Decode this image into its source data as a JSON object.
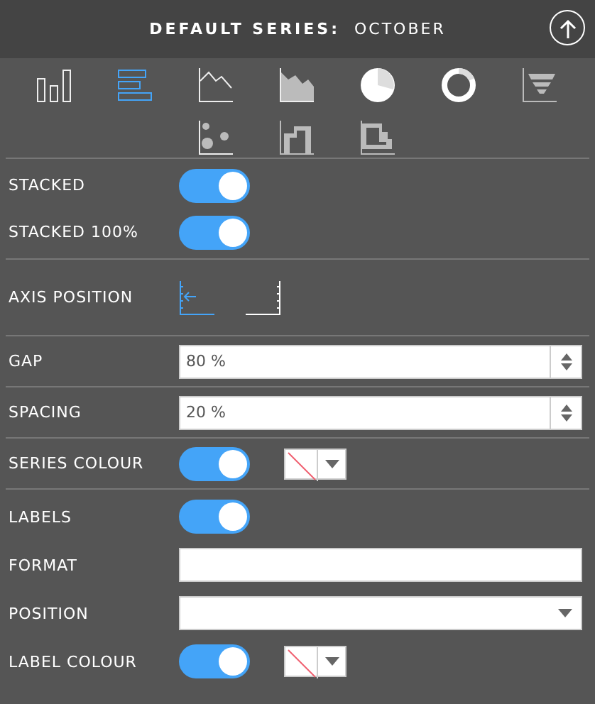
{
  "header": {
    "label": "DEFAULT SERIES:",
    "value": "OCTOBER"
  },
  "chart_types": [
    {
      "kind": "column",
      "selected": false
    },
    {
      "kind": "bar",
      "selected": true
    },
    {
      "kind": "line",
      "selected": false
    },
    {
      "kind": "area",
      "selected": false
    },
    {
      "kind": "pie",
      "selected": false
    },
    {
      "kind": "donut",
      "selected": false
    },
    {
      "kind": "funnel",
      "selected": false
    },
    {
      "kind": "scatter",
      "selected": false
    },
    {
      "kind": "step",
      "selected": false
    },
    {
      "kind": "stepbar",
      "selected": false
    }
  ],
  "groups": [
    [
      {
        "kind": "toggle",
        "label": "STACKED",
        "on": true
      },
      {
        "kind": "toggle",
        "label": "STACKED 100%",
        "on": true
      }
    ],
    [
      {
        "kind": "axis",
        "label": "AXIS POSITION",
        "options": [
          {
            "kind": "left",
            "selected": true
          },
          {
            "kind": "right",
            "selected": false
          }
        ]
      }
    ],
    [
      {
        "kind": "spinner",
        "label": "GAP",
        "value": "80 %"
      }
    ],
    [
      {
        "kind": "spinner",
        "label": "SPACING",
        "value": "20 %"
      }
    ],
    [
      {
        "kind": "colour",
        "label": "SERIES COLOUR",
        "on": true
      }
    ],
    [
      {
        "kind": "toggle",
        "label": "LABELS",
        "on": true
      },
      {
        "kind": "text",
        "label": "FORMAT"
      },
      {
        "kind": "select",
        "label": "POSITION"
      },
      {
        "kind": "colour",
        "label": "LABEL COLOUR",
        "on": true
      }
    ]
  ]
}
